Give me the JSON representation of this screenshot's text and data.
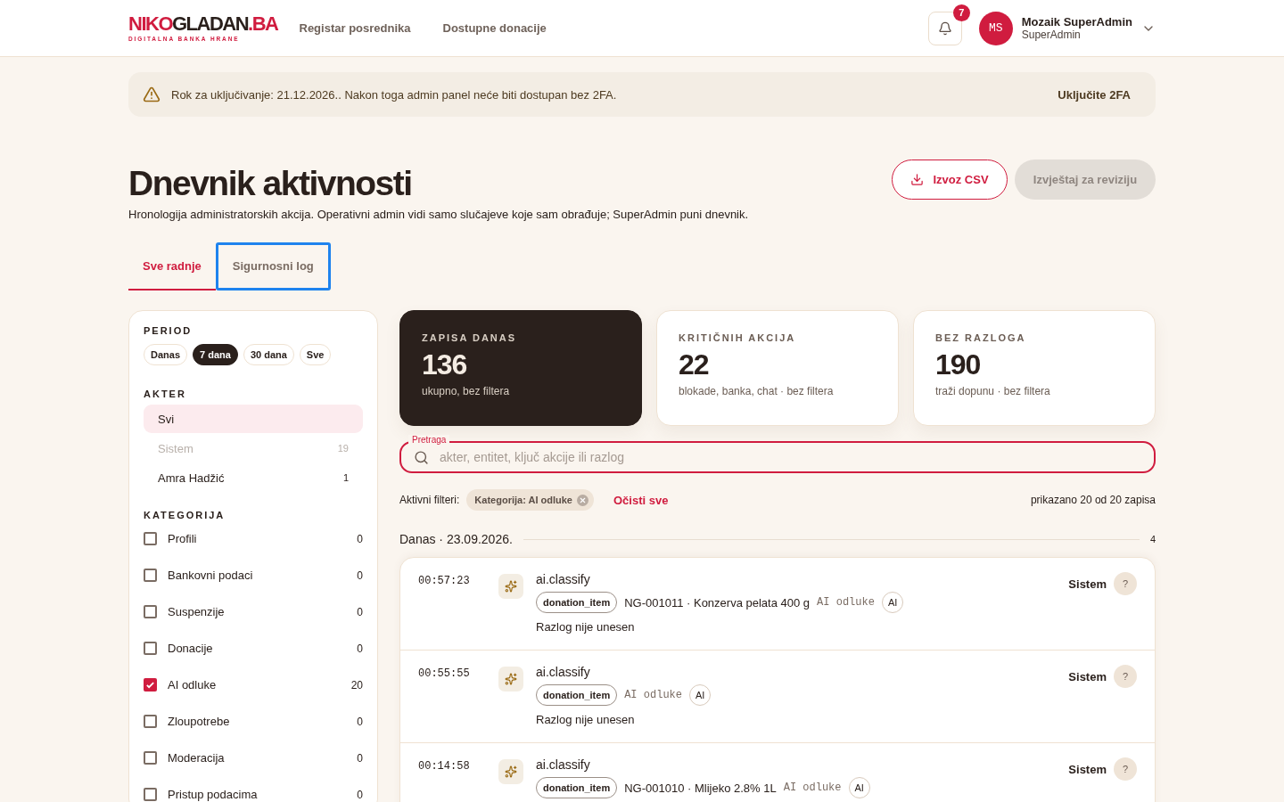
{
  "header": {
    "logo": {
      "red_part": "NIKO",
      "dark_part": "GLADAN",
      "suffix": ".BA",
      "tagline": "DIGITALNA BANKA HRANE"
    },
    "nav": [
      "Registar posrednika",
      "Dostupne donacije"
    ],
    "notifications": "7",
    "user": {
      "initials": "MS",
      "name": "Mozaik SuperAdmin",
      "role": "SuperAdmin"
    }
  },
  "banner": {
    "text": "Rok za uključivanje: 21.12.2026.. Nakon toga admin panel neće biti dostupan bez 2FA.",
    "action": "Uključite 2FA"
  },
  "page": {
    "title": "Dnevnik aktivnosti",
    "subtitle": "Hronologija administratorskih akcija. Operativni admin vidi samo slučajeve koje sam obrađuje; SuperAdmin puni dnevnik.",
    "buttons": [
      {
        "label": "Izvoz CSV",
        "kind": "outline",
        "disabled": false
      },
      {
        "label": "Izvještaj za reviziju",
        "kind": "filled",
        "disabled": true
      }
    ]
  },
  "tabs": [
    {
      "label": "Sve radnje",
      "selected": true,
      "focused": false
    },
    {
      "label": "Sigurnosni log",
      "selected": false,
      "focused": true
    }
  ],
  "filters": {
    "period": {
      "title": "PERIOD",
      "options": [
        {
          "label": "Danas",
          "selected": false
        },
        {
          "label": "7 dana",
          "selected": true
        },
        {
          "label": "30 dana",
          "selected": false
        },
        {
          "label": "Sve",
          "selected": false
        }
      ]
    },
    "actor": {
      "title": "AKTER",
      "items": [
        {
          "name": "Svi",
          "selected": true,
          "disabled": false
        },
        {
          "name": "Sistem",
          "count": "19",
          "selected": false,
          "disabled": true
        },
        {
          "name": "Amra Hadžić",
          "count": "1",
          "selected": false,
          "disabled": false
        }
      ]
    },
    "category": {
      "title": "KATEGORIJA",
      "items": [
        {
          "label": "Profili",
          "count": "0",
          "checked": false
        },
        {
          "label": "Bankovni podaci",
          "count": "0",
          "checked": false
        },
        {
          "label": "Suspenzije",
          "count": "0",
          "checked": false
        },
        {
          "label": "Donacije",
          "count": "0",
          "checked": false
        },
        {
          "label": "AI odluke",
          "count": "20",
          "checked": true
        },
        {
          "label": "Zloupotrebe",
          "count": "0",
          "checked": false
        },
        {
          "label": "Moderacija",
          "count": "0",
          "checked": false
        },
        {
          "label": "Pristup podacima",
          "count": "0",
          "checked": false
        }
      ]
    }
  },
  "stats": [
    {
      "label": "ZAPISA DANAS",
      "value": "136",
      "note": "ukupno, bez filtera",
      "kind": "dark"
    },
    {
      "label": "KRITIČNIH AKCIJA",
      "value": "22",
      "note": "blokade, banka, chat · bez filtera",
      "kind": "light"
    },
    {
      "label": "BEZ RAZLOGA",
      "value": "190",
      "note": "traži dopunu · bez filtera",
      "kind": "light"
    }
  ],
  "search": {
    "label": "Pretraga",
    "placeholder": "akter, entitet, ključ akcije ili razlog"
  },
  "active_filters": {
    "label": "Aktivni filteri:",
    "chips": [
      "Kategorija: AI odluke"
    ],
    "clear": "Očisti sve",
    "summary": "prikazano 20 od 20 zapisa"
  },
  "day": {
    "label": "Danas · 23.09.2026.",
    "count": "4"
  },
  "entries": [
    {
      "time": "00:57:23",
      "action": "ai.classify",
      "entity_type": "donation_item",
      "entity": "NG-001011 · Konzerva pelata 400 g",
      "category": "AI odluke",
      "badge": "AI",
      "reason": "Razlog nije unesen",
      "actor": "Sistem",
      "actor_mark": "?"
    },
    {
      "time": "00:55:55",
      "action": "ai.classify",
      "entity_type": "donation_item",
      "category": "AI odluke",
      "badge": "AI",
      "reason": "Razlog nije unesen",
      "actor": "Sistem",
      "actor_mark": "?"
    },
    {
      "time": "00:14:58",
      "action": "ai.classify",
      "entity_type": "donation_item",
      "entity": "NG-001010 · Mlijeko 2.8% 1L",
      "category": "AI odluke",
      "badge": "AI",
      "actor": "Sistem",
      "actor_mark": "?"
    }
  ]
}
